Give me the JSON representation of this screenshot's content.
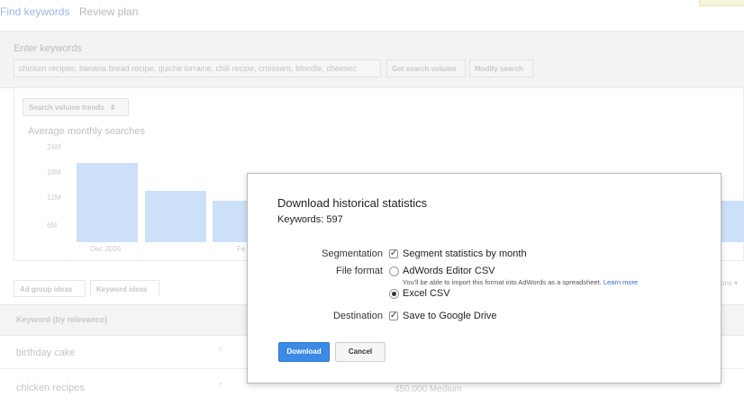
{
  "nav": {
    "tabs": [
      {
        "label": "Find keywords",
        "active": true
      },
      {
        "label": "Review plan",
        "active": false
      }
    ]
  },
  "search": {
    "label": "Enter keywords",
    "value": "chicken recipes, banana bread recipe, quiche lorraine, chili recipe, croissant, blondie, cheesec",
    "get_volume_label": "Get search volume",
    "modify_label": "Modify search"
  },
  "chart_card": {
    "dropdown_label": "Search volume trends",
    "dropdown_icon": "sort-arrows-icon"
  },
  "chart_data": {
    "type": "bar",
    "title": "Average monthly searches",
    "yticks": [
      "24M",
      "18M",
      "12M",
      "6M"
    ],
    "ylim": [
      0,
      24000000
    ],
    "categories_visible": [
      "Dec 2016",
      "Fe"
    ],
    "values_approx": [
      20000000,
      13000000,
      10500000,
      10500000
    ],
    "bar_color": "#cde0fa"
  },
  "ideas": {
    "tabs": [
      "Ad group ideas",
      "Keyword ideas"
    ],
    "active_tab": "Keyword ideas",
    "right_text": "ons",
    "column_keyword": "Keyword (by relevance)",
    "rows": [
      {
        "keyword": "birthday cake",
        "volume": ""
      },
      {
        "keyword": "chicken recipes",
        "volume": "450,000  Medium"
      }
    ],
    "trend_icon": "chart-icon"
  },
  "modal": {
    "title": "Download historical statistics",
    "keywords_line": "Keywords: 597",
    "segmentation_label": "Segmentation",
    "segmentation_option": "Segment statistics by month",
    "segmentation_checked": true,
    "file_format_label": "File format",
    "format_option_1": "AdWords Editor CSV",
    "format_option_1_help": "You'll be able to import this format into AdWords as a spreadsheet.",
    "learn_more": "Learn more",
    "format_option_2": "Excel CSV",
    "selected_format": "Excel CSV",
    "destination_label": "Destination",
    "destination_option": "Save to Google Drive",
    "destination_checked": true,
    "download_label": "Download",
    "cancel_label": "Cancel",
    "accent_color": "#3b8be6",
    "check_glyph": "✓"
  }
}
